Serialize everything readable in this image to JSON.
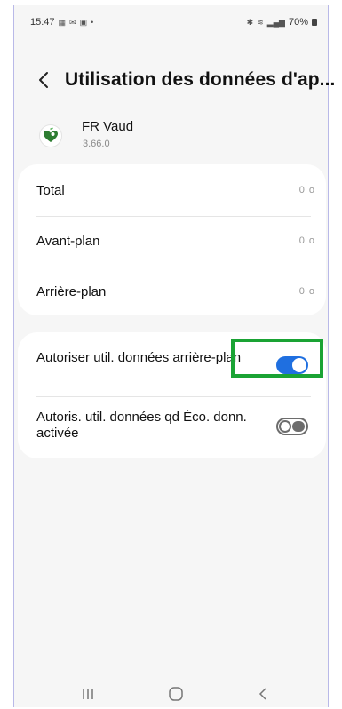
{
  "status_bar": {
    "time": "15:47",
    "battery": "70%",
    "left_icons": [
      "gallery-icon",
      "mail-icon",
      "image-icon",
      "dot-icon"
    ],
    "right_icons": [
      "bluetooth-icon",
      "wifi-icon",
      "volte-icon",
      "signal-icon"
    ]
  },
  "header": {
    "title": "Utilisation des données d'ap..."
  },
  "app": {
    "name": "FR Vaud",
    "version": "3.66.0"
  },
  "usage": {
    "rows": [
      {
        "label": "Total",
        "value": "0 o"
      },
      {
        "label": "Avant-plan",
        "value": "0 o"
      },
      {
        "label": "Arrière-plan",
        "value": "0 o"
      }
    ]
  },
  "settings": {
    "background_data": {
      "label": "Autoriser util. données arrière-plan",
      "enabled": true
    },
    "data_saver": {
      "label": "Autoris. util. données qd Éco. donn. activée",
      "enabled": false
    }
  },
  "colors": {
    "accent": "#1f6fe0",
    "highlight": "#1aa334",
    "app_icon": "#2e7d32"
  },
  "nav": {
    "icons": [
      "recent-apps-icon",
      "home-icon",
      "back-icon"
    ]
  }
}
